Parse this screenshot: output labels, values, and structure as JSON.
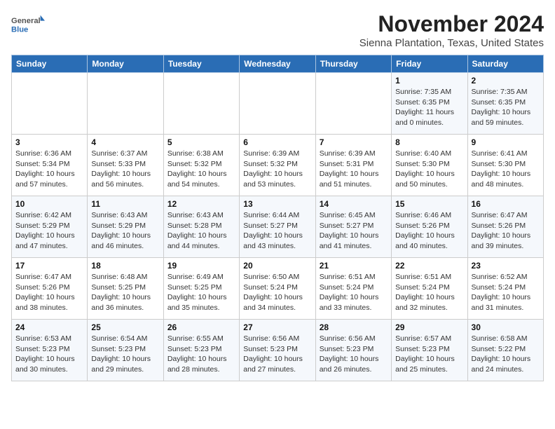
{
  "logo": {
    "general": "General",
    "blue": "Blue"
  },
  "title": "November 2024",
  "subtitle": "Sienna Plantation, Texas, United States",
  "weekdays": [
    "Sunday",
    "Monday",
    "Tuesday",
    "Wednesday",
    "Thursday",
    "Friday",
    "Saturday"
  ],
  "weeks": [
    [
      {
        "day": "",
        "info": ""
      },
      {
        "day": "",
        "info": ""
      },
      {
        "day": "",
        "info": ""
      },
      {
        "day": "",
        "info": ""
      },
      {
        "day": "",
        "info": ""
      },
      {
        "day": "1",
        "info": "Sunrise: 7:35 AM\nSunset: 6:35 PM\nDaylight: 11 hours and 0 minutes."
      },
      {
        "day": "2",
        "info": "Sunrise: 7:35 AM\nSunset: 6:35 PM\nDaylight: 10 hours and 59 minutes."
      }
    ],
    [
      {
        "day": "3",
        "info": "Sunrise: 6:36 AM\nSunset: 5:34 PM\nDaylight: 10 hours and 57 minutes."
      },
      {
        "day": "4",
        "info": "Sunrise: 6:37 AM\nSunset: 5:33 PM\nDaylight: 10 hours and 56 minutes."
      },
      {
        "day": "5",
        "info": "Sunrise: 6:38 AM\nSunset: 5:32 PM\nDaylight: 10 hours and 54 minutes."
      },
      {
        "day": "6",
        "info": "Sunrise: 6:39 AM\nSunset: 5:32 PM\nDaylight: 10 hours and 53 minutes."
      },
      {
        "day": "7",
        "info": "Sunrise: 6:39 AM\nSunset: 5:31 PM\nDaylight: 10 hours and 51 minutes."
      },
      {
        "day": "8",
        "info": "Sunrise: 6:40 AM\nSunset: 5:30 PM\nDaylight: 10 hours and 50 minutes."
      },
      {
        "day": "9",
        "info": "Sunrise: 6:41 AM\nSunset: 5:30 PM\nDaylight: 10 hours and 48 minutes."
      }
    ],
    [
      {
        "day": "10",
        "info": "Sunrise: 6:42 AM\nSunset: 5:29 PM\nDaylight: 10 hours and 47 minutes."
      },
      {
        "day": "11",
        "info": "Sunrise: 6:43 AM\nSunset: 5:29 PM\nDaylight: 10 hours and 46 minutes."
      },
      {
        "day": "12",
        "info": "Sunrise: 6:43 AM\nSunset: 5:28 PM\nDaylight: 10 hours and 44 minutes."
      },
      {
        "day": "13",
        "info": "Sunrise: 6:44 AM\nSunset: 5:27 PM\nDaylight: 10 hours and 43 minutes."
      },
      {
        "day": "14",
        "info": "Sunrise: 6:45 AM\nSunset: 5:27 PM\nDaylight: 10 hours and 41 minutes."
      },
      {
        "day": "15",
        "info": "Sunrise: 6:46 AM\nSunset: 5:26 PM\nDaylight: 10 hours and 40 minutes."
      },
      {
        "day": "16",
        "info": "Sunrise: 6:47 AM\nSunset: 5:26 PM\nDaylight: 10 hours and 39 minutes."
      }
    ],
    [
      {
        "day": "17",
        "info": "Sunrise: 6:47 AM\nSunset: 5:26 PM\nDaylight: 10 hours and 38 minutes."
      },
      {
        "day": "18",
        "info": "Sunrise: 6:48 AM\nSunset: 5:25 PM\nDaylight: 10 hours and 36 minutes."
      },
      {
        "day": "19",
        "info": "Sunrise: 6:49 AM\nSunset: 5:25 PM\nDaylight: 10 hours and 35 minutes."
      },
      {
        "day": "20",
        "info": "Sunrise: 6:50 AM\nSunset: 5:24 PM\nDaylight: 10 hours and 34 minutes."
      },
      {
        "day": "21",
        "info": "Sunrise: 6:51 AM\nSunset: 5:24 PM\nDaylight: 10 hours and 33 minutes."
      },
      {
        "day": "22",
        "info": "Sunrise: 6:51 AM\nSunset: 5:24 PM\nDaylight: 10 hours and 32 minutes."
      },
      {
        "day": "23",
        "info": "Sunrise: 6:52 AM\nSunset: 5:24 PM\nDaylight: 10 hours and 31 minutes."
      }
    ],
    [
      {
        "day": "24",
        "info": "Sunrise: 6:53 AM\nSunset: 5:23 PM\nDaylight: 10 hours and 30 minutes."
      },
      {
        "day": "25",
        "info": "Sunrise: 6:54 AM\nSunset: 5:23 PM\nDaylight: 10 hours and 29 minutes."
      },
      {
        "day": "26",
        "info": "Sunrise: 6:55 AM\nSunset: 5:23 PM\nDaylight: 10 hours and 28 minutes."
      },
      {
        "day": "27",
        "info": "Sunrise: 6:56 AM\nSunset: 5:23 PM\nDaylight: 10 hours and 27 minutes."
      },
      {
        "day": "28",
        "info": "Sunrise: 6:56 AM\nSunset: 5:23 PM\nDaylight: 10 hours and 26 minutes."
      },
      {
        "day": "29",
        "info": "Sunrise: 6:57 AM\nSunset: 5:23 PM\nDaylight: 10 hours and 25 minutes."
      },
      {
        "day": "30",
        "info": "Sunrise: 6:58 AM\nSunset: 5:22 PM\nDaylight: 10 hours and 24 minutes."
      }
    ]
  ]
}
